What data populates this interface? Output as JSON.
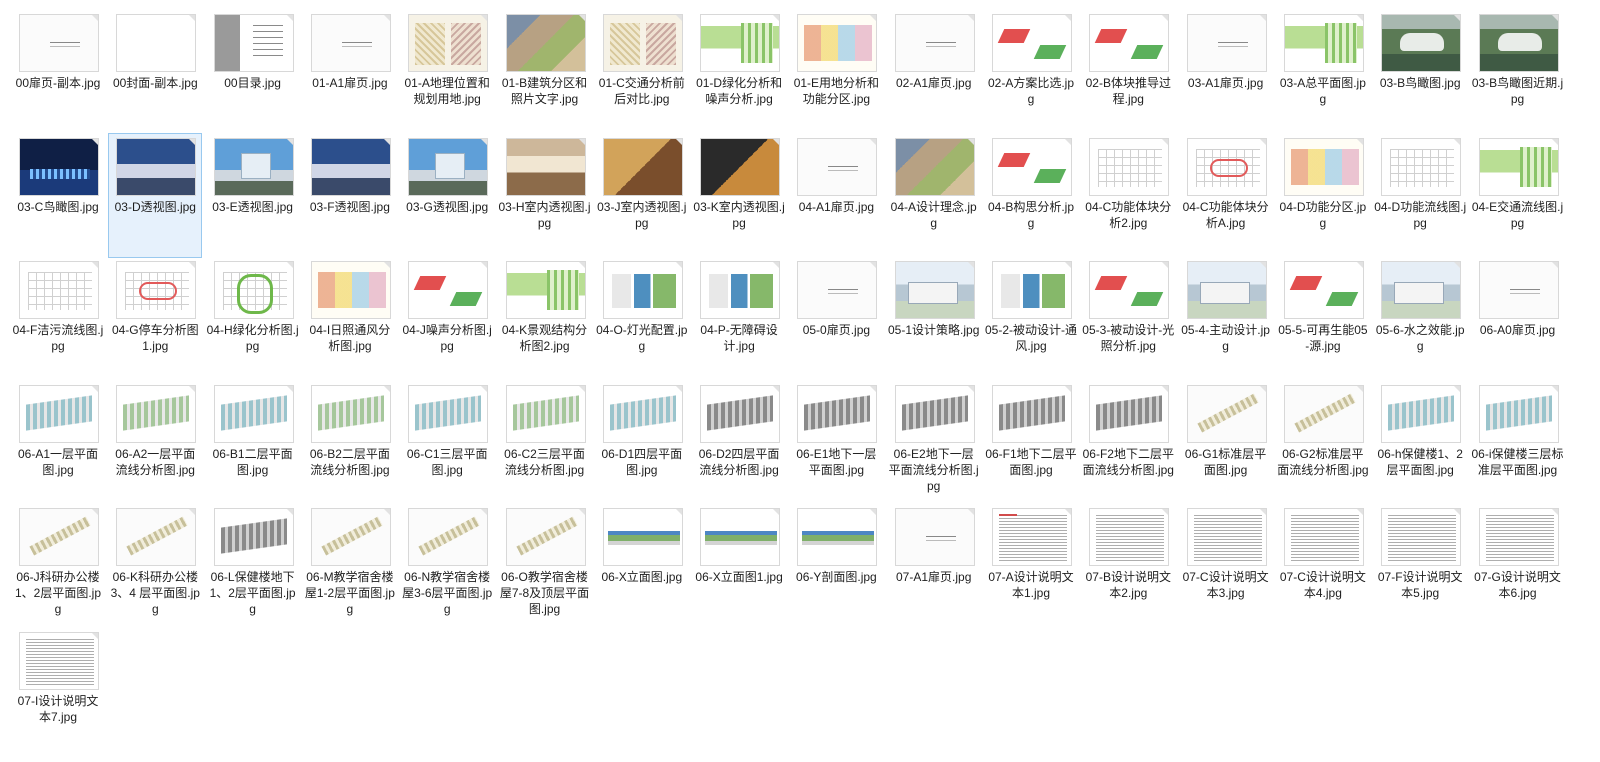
{
  "files": [
    {
      "name": "00扉页-副本.jpg",
      "thumb": "title"
    },
    {
      "name": "00封面-副本.jpg",
      "thumb": "blank"
    },
    {
      "name": "00目录.jpg",
      "thumb": "toc"
    },
    {
      "name": "01-A1扉页.jpg",
      "thumb": "title"
    },
    {
      "name": "01-A地理位置和规划用地.jpg",
      "thumb": "map"
    },
    {
      "name": "01-B建筑分区和照片文字.jpg",
      "thumb": "photo"
    },
    {
      "name": "01-C交通分析前后对比.jpg",
      "thumb": "map"
    },
    {
      "name": "01-D绿化分析和噪声分析.jpg",
      "thumb": "green"
    },
    {
      "name": "01-E用地分析和功能分区.jpg",
      "thumb": "color"
    },
    {
      "name": "02-A1扉页.jpg",
      "thumb": "title"
    },
    {
      "name": "02-A方案比选.jpg",
      "thumb": "iso"
    },
    {
      "name": "02-B体块推导过程.jpg",
      "thumb": "iso"
    },
    {
      "name": "03-A1扉页.jpg",
      "thumb": "title"
    },
    {
      "name": "03-A总平面图.jpg",
      "thumb": "green"
    },
    {
      "name": "03-B鸟瞰图.jpg",
      "thumb": "aerial"
    },
    {
      "name": "03-B鸟瞰图近期.jpg",
      "thumb": "aerial"
    },
    {
      "name": "03-C鸟瞰图.jpg",
      "thumb": "night"
    },
    {
      "name": "03-D透视图.jpg",
      "thumb": "dusk",
      "selected": true
    },
    {
      "name": "03-E透视图.jpg",
      "thumb": "day"
    },
    {
      "name": "03-F透视图.jpg",
      "thumb": "dusk"
    },
    {
      "name": "03-G透视图.jpg",
      "thumb": "day"
    },
    {
      "name": "03-H室内透视图.jpg",
      "thumb": "interior"
    },
    {
      "name": "03-J室内透视图.jpg",
      "thumb": "interior-b"
    },
    {
      "name": "03-K室内透视图.jpg",
      "thumb": "interior-c"
    },
    {
      "name": "04-A1扉页.jpg",
      "thumb": "title"
    },
    {
      "name": "04-A设计理念.jpg",
      "thumb": "photo"
    },
    {
      "name": "04-B构思分析.jpg",
      "thumb": "iso"
    },
    {
      "name": "04-C功能体块分析2.jpg",
      "thumb": "diagram"
    },
    {
      "name": "04-C功能体块分析A.jpg",
      "thumb": "diagram-red"
    },
    {
      "name": "04-D功能分区.jpg",
      "thumb": "color"
    },
    {
      "name": "04-D功能流线图.jpg",
      "thumb": "diagram"
    },
    {
      "name": "04-E交通流线图.jpg",
      "thumb": "green"
    },
    {
      "name": "04-F洁污流线图.jpg",
      "thumb": "diagram"
    },
    {
      "name": "04-G停车分析图1.jpg",
      "thumb": "diagram-red"
    },
    {
      "name": "04-H绿化分析图.jpg",
      "thumb": "diagram-green"
    },
    {
      "name": "04-I日照通风分析图.jpg",
      "thumb": "color"
    },
    {
      "name": "04-J噪声分析图.jpg",
      "thumb": "iso"
    },
    {
      "name": "04-K景观结构分析图2.jpg",
      "thumb": "green"
    },
    {
      "name": "04-O-灯光配置.jpg",
      "thumb": "panel"
    },
    {
      "name": "04-P-无障碍设计.jpg",
      "thumb": "panel"
    },
    {
      "name": "05-0扉页.jpg",
      "thumb": "title"
    },
    {
      "name": "05-1设计策略.jpg",
      "thumb": "render"
    },
    {
      "name": "05-2-被动设计-通风.jpg",
      "thumb": "panel"
    },
    {
      "name": "05-3-被动设计-光照分析.jpg",
      "thumb": "iso"
    },
    {
      "name": "05-4-主动设计.jpg",
      "thumb": "render"
    },
    {
      "name": "05-5-可再生能05-源.jpg",
      "thumb": "iso"
    },
    {
      "name": "05-6-水之效能.jpg",
      "thumb": "render"
    },
    {
      "name": "06-A0扉页.jpg",
      "thumb": "title"
    },
    {
      "name": "06-A1一层平面图.jpg",
      "thumb": "plan"
    },
    {
      "name": "06-A2一层平面流线分析图.jpg",
      "thumb": "plan-green"
    },
    {
      "name": "06-B1二层平面图.jpg",
      "thumb": "plan"
    },
    {
      "name": "06-B2二层平面流线分析图.jpg",
      "thumb": "plan-green"
    },
    {
      "name": "06-C1三层平面图.jpg",
      "thumb": "plan"
    },
    {
      "name": "06-C2三层平面流线分析图.jpg",
      "thumb": "plan-green"
    },
    {
      "name": "06-D1四层平面图.jpg",
      "thumb": "plan"
    },
    {
      "name": "06-D2四层平面流线分析图.jpg",
      "thumb": "plan-gray"
    },
    {
      "name": "06-E1地下一层平面图.jpg",
      "thumb": "plan-gray"
    },
    {
      "name": "06-E2地下一层平面流线分析图.jpg",
      "thumb": "plan-gray"
    },
    {
      "name": "06-F1地下二层平面图.jpg",
      "thumb": "plan-gray"
    },
    {
      "name": "06-F2地下二层平面流线分析图.jpg",
      "thumb": "plan-gray"
    },
    {
      "name": "06-G1标准层平面图.jpg",
      "thumb": "strip"
    },
    {
      "name": "06-G2标准层平面流线分析图.jpg",
      "thumb": "strip"
    },
    {
      "name": "06-h保健楼1、2层平面图.jpg",
      "thumb": "plan"
    },
    {
      "name": "06-i保健楼三层标准层平面图.jpg",
      "thumb": "plan"
    },
    {
      "name": "06-J科研办公楼1、2层平面图.jpg",
      "thumb": "strip"
    },
    {
      "name": "06-K科研办公楼3、4 层平面图.jpg",
      "thumb": "strip"
    },
    {
      "name": "06-L保健楼地下1、2层平面图.jpg",
      "thumb": "plan-gray"
    },
    {
      "name": "06-M教学宿舍楼屋1-2层平面图.jpg",
      "thumb": "strip"
    },
    {
      "name": "06-N教学宿舍楼屋3-6层平面图.jpg",
      "thumb": "strip"
    },
    {
      "name": "06-O教学宿舍楼屋7-8及顶层平面图.jpg",
      "thumb": "strip"
    },
    {
      "name": "06-X立面图.jpg",
      "thumb": "elev"
    },
    {
      "name": "06-X立面图1.jpg",
      "thumb": "elev"
    },
    {
      "name": "06-Y剖面图.jpg",
      "thumb": "elev"
    },
    {
      "name": "07-A1扉页.jpg",
      "thumb": "title"
    },
    {
      "name": "07-A设计说明文本1.jpg",
      "thumb": "text-red"
    },
    {
      "name": "07-B设计说明文本2.jpg",
      "thumb": "text"
    },
    {
      "name": "07-C设计说明文本3.jpg",
      "thumb": "text"
    },
    {
      "name": "07-C设计说明文本4.jpg",
      "thumb": "text"
    },
    {
      "name": "07-F设计说明文本5.jpg",
      "thumb": "text"
    },
    {
      "name": "07-G设计说明文本6.jpg",
      "thumb": "text"
    },
    {
      "name": "07-I设计说明文本7.jpg",
      "thumb": "text"
    }
  ]
}
